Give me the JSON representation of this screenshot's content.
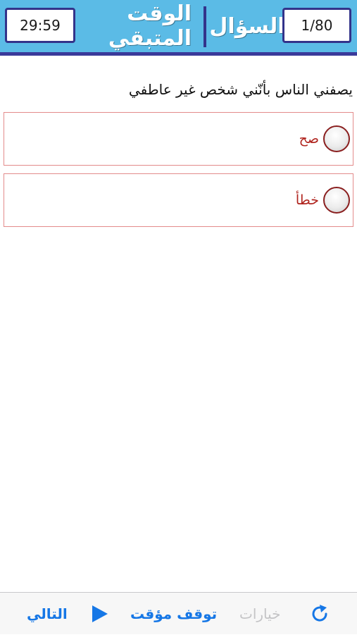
{
  "header": {
    "timer_value": "29:59",
    "time_left_label": "الوقت المتبقي",
    "question_label": "السؤال",
    "question_counter": "1/80"
  },
  "question": {
    "text": "يصفني الناس بأنّني شخص غير عاطفي"
  },
  "answers": [
    {
      "label": "صح"
    },
    {
      "label": "خطأ"
    }
  ],
  "toolbar": {
    "next_label": "التالي",
    "pause_timer_label": "توقف مؤقت",
    "options_label": "خيارات",
    "play_icon": "play-icon",
    "refresh_icon": "refresh-icon"
  },
  "colors": {
    "header_bg": "#5bbbe6",
    "header_accent": "#33338a",
    "answer_text": "#b0241e",
    "toolbar_tint": "#1677e6"
  }
}
